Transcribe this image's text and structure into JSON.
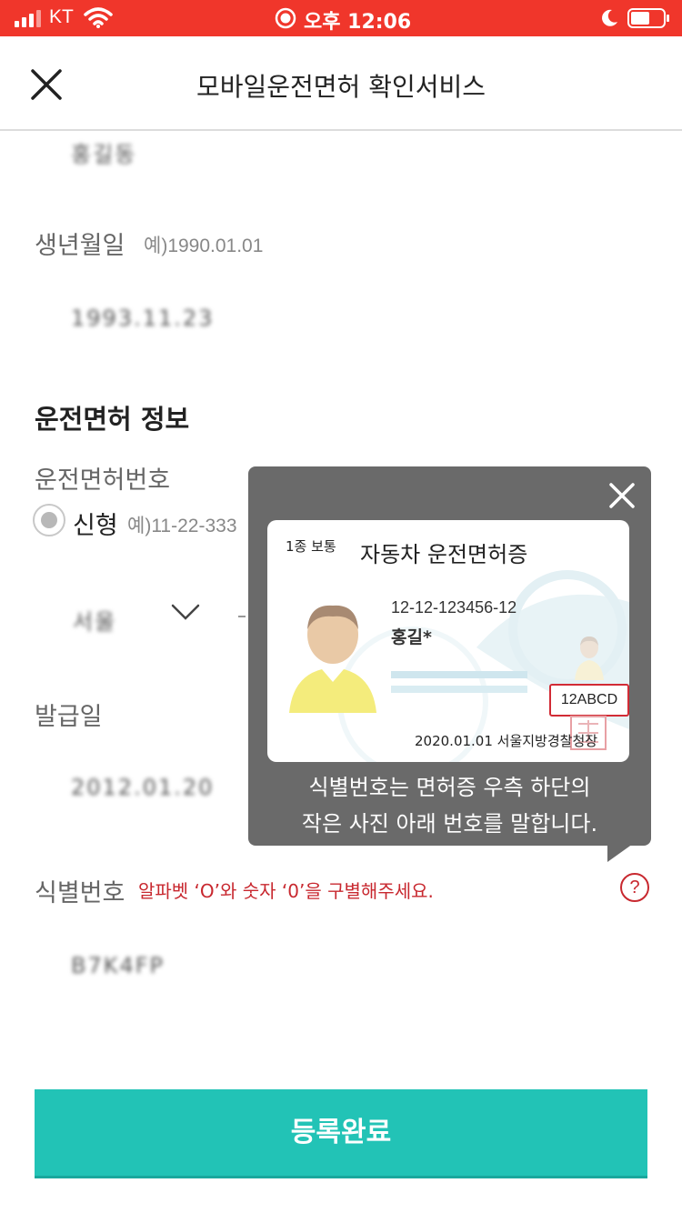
{
  "status_bar": {
    "carrier": "KT",
    "time": "오후 12:06"
  },
  "header": {
    "title": "모바일운전면허 확인서비스"
  },
  "form": {
    "name_value_blurred": "홍길동",
    "birth": {
      "label": "생년월일",
      "hint": "예)1990.01.01",
      "value_blurred": "1993.11.23"
    },
    "license_section_title": "운전면허 정보",
    "license_number": {
      "label": "운전면허번호",
      "radio_label": "신형",
      "radio_hint": "예)11-22-333",
      "region_value_blurred": "서울"
    },
    "issue_date": {
      "label": "발급일",
      "value_blurred": "2012.01.20"
    },
    "id_number": {
      "label": "식별번호",
      "warning": "알파벳 ‘O’와 숫자 ‘0’을 구별해주세요.",
      "help_symbol": "?",
      "value_blurred": "B7K4FP"
    }
  },
  "submit_button": {
    "label": "등록완료"
  },
  "tooltip": {
    "line1": "식별번호는 면허증 우측 하단의",
    "line2": "작은 사진 아래 번호를 말합니다.",
    "card": {
      "license_class": "1종 보통",
      "title": "자동차 운전면허증",
      "number": "12-12-123456-12",
      "name": "홍길*",
      "id_code": "12ABCD",
      "issue_info": "2020.01.01  서울지방경찰청장"
    }
  },
  "colors": {
    "status_bar": "#f0362b",
    "accent": "#22c3b6",
    "warning": "#c8282f",
    "tooltip_bg": "#6a6a6a"
  }
}
